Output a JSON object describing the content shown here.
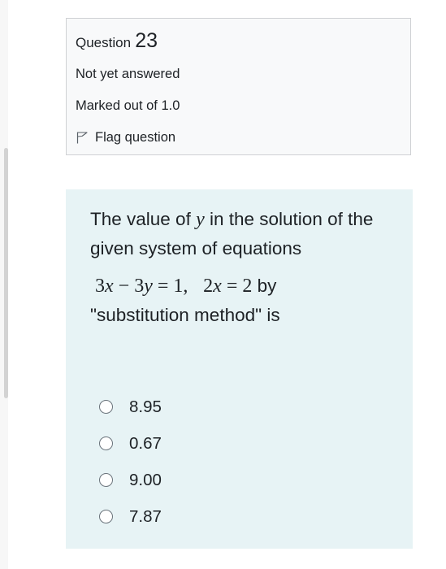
{
  "question": {
    "label": "Question",
    "number": "23",
    "state": "Not yet answered",
    "grade": "Marked out of 1.0",
    "flag_label": "Flag question",
    "flag_icon": "flag-outline-icon"
  },
  "qtext": {
    "part1": "The value of ",
    "var_y": "y",
    "part2": " in the solution of the given system of equations",
    "eq1_a": "3",
    "eq1_x": "x",
    "eq1_mid": " − 3",
    "eq1_y": "y",
    "eq1_rhs": " = 1,",
    "eq2_a": "2",
    "eq2_x": "x",
    "eq2_rhs": " = 2",
    "by": " by",
    "method": "\"substitution method\" is"
  },
  "answers": [
    {
      "label": "8.95"
    },
    {
      "label": "0.67"
    },
    {
      "label": "9.00"
    },
    {
      "label": "7.87"
    }
  ],
  "colors": {
    "info_bg": "#f8f9fa",
    "info_border": "#cfd1d4",
    "formulation_bg": "#e7f3f5",
    "text": "#1d2125",
    "radio_border": "#6a737b"
  }
}
